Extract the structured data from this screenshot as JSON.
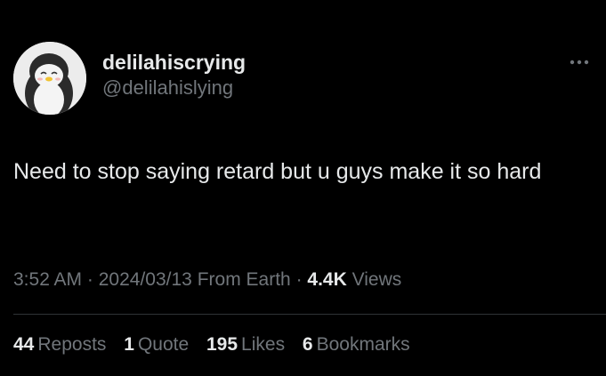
{
  "user": {
    "display_name": "delilahiscrying",
    "handle": "@delilahislying",
    "avatar_icon": "penguin-avatar-icon"
  },
  "menu_icon": "more-options-icon",
  "tweet": {
    "text": "Need to stop saying retard but u guys make it so hard"
  },
  "meta": {
    "time": "3:52 AM",
    "separator": "·",
    "date": "2024/03/13",
    "source": "From Earth",
    "views_count": "4.4K",
    "views_label": "Views"
  },
  "stats": {
    "reposts_count": "44",
    "reposts_label": "Reposts",
    "quote_count": "1",
    "quote_label": "Quote",
    "likes_count": "195",
    "likes_label": "Likes",
    "bookmarks_count": "6",
    "bookmarks_label": "Bookmarks"
  },
  "colors": {
    "background": "#000000",
    "primary_text": "#e7e9ea",
    "secondary_text": "#71767b",
    "divider": "#2f3336"
  }
}
